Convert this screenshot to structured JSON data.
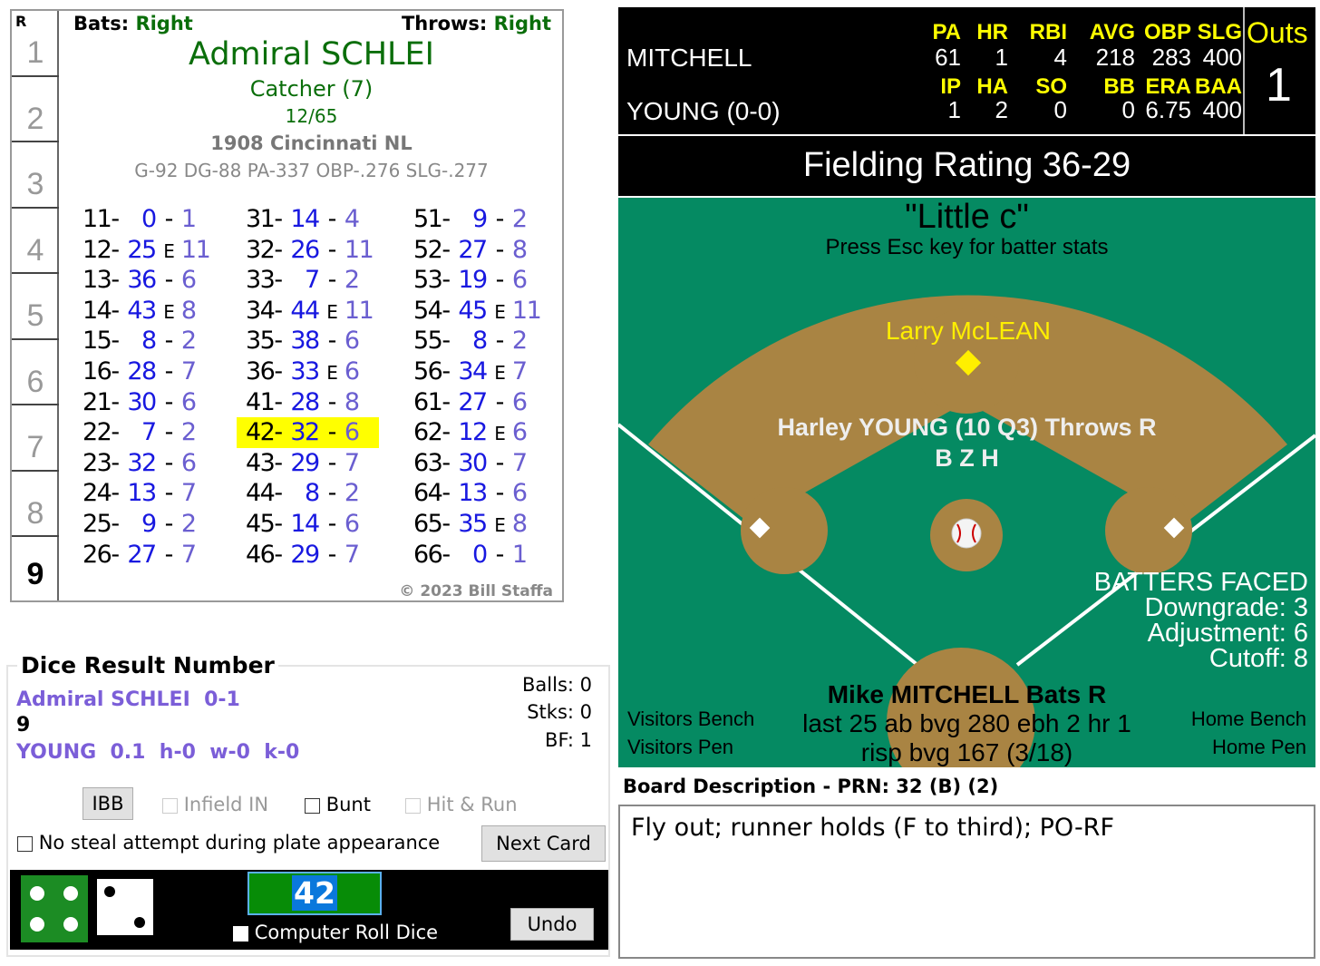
{
  "card": {
    "hand": "R",
    "rows": [
      "1",
      "2",
      "3",
      "4",
      "5",
      "6",
      "7",
      "8",
      "9"
    ],
    "current_row": "9",
    "bats_label": "Bats:",
    "bats": "Right",
    "throws_label": "Throws:",
    "throws": "Right",
    "name": "Admiral SCHLEI",
    "position": "Catcher (7)",
    "ratio": "12/65",
    "team": "1908 Cincinnati NL",
    "stats": "G-92 DG-88 PA-337 OBP-.276 SLG-.277",
    "copyright": "© 2023 Bill Staffa",
    "columns": [
      [
        [
          "11-",
          "0",
          "-",
          "1"
        ],
        [
          "12-",
          "25",
          "E",
          "11"
        ],
        [
          "13-",
          "36",
          "-",
          "6"
        ],
        [
          "14-",
          "43",
          "E",
          "8"
        ],
        [
          "15-",
          "8",
          "-",
          "2"
        ],
        [
          "16-",
          "28",
          "-",
          "7"
        ],
        [
          "21-",
          "30",
          "-",
          "6"
        ],
        [
          "22-",
          "7",
          "-",
          "2"
        ],
        [
          "23-",
          "32",
          "-",
          "6"
        ],
        [
          "24-",
          "13",
          "-",
          "7"
        ],
        [
          "25-",
          "9",
          "-",
          "2"
        ],
        [
          "26-",
          "27",
          "-",
          "7"
        ]
      ],
      [
        [
          "31-",
          "14",
          "-",
          "4"
        ],
        [
          "32-",
          "26",
          "-",
          "11"
        ],
        [
          "33-",
          "7",
          "-",
          "2"
        ],
        [
          "34-",
          "44",
          "E",
          "11"
        ],
        [
          "35-",
          "38",
          "-",
          "6"
        ],
        [
          "36-",
          "33",
          "E",
          "6"
        ],
        [
          "41-",
          "28",
          "-",
          "8"
        ],
        [
          "42-",
          "32",
          "-",
          "6"
        ],
        [
          "43-",
          "29",
          "-",
          "7"
        ],
        [
          "44-",
          "8",
          "-",
          "2"
        ],
        [
          "45-",
          "14",
          "-",
          "6"
        ],
        [
          "46-",
          "29",
          "-",
          "7"
        ]
      ],
      [
        [
          "51-",
          "9",
          "-",
          "2"
        ],
        [
          "52-",
          "27",
          "-",
          "8"
        ],
        [
          "53-",
          "19",
          "-",
          "6"
        ],
        [
          "54-",
          "45",
          "E",
          "11"
        ],
        [
          "55-",
          "8",
          "-",
          "2"
        ],
        [
          "56-",
          "34",
          "E",
          "7"
        ],
        [
          "61-",
          "27",
          "-",
          "6"
        ],
        [
          "62-",
          "12",
          "E",
          "6"
        ],
        [
          "63-",
          "30",
          "-",
          "7"
        ],
        [
          "64-",
          "13",
          "-",
          "6"
        ],
        [
          "65-",
          "35",
          "E",
          "8"
        ],
        [
          "66-",
          "0",
          "-",
          "1"
        ]
      ]
    ],
    "highlighted": "42-"
  },
  "dice": {
    "title": "Dice Result Number",
    "batter_line": "Admiral SCHLEI  0-1",
    "row": "9",
    "pitcher_line": "YOUNG  0.1  h-0  w-0  k-0",
    "balls": "Balls: 0",
    "strikes": "Stks: 0",
    "bf": "BF: 1",
    "ibb": "IBB",
    "infield_in": "Infield IN",
    "bunt": "Bunt",
    "hit_run": "Hit & Run",
    "no_steal": "No steal attempt during plate appearance",
    "next_card": "Next Card",
    "result": "42",
    "computer_roll": "Computer Roll Dice",
    "undo": "Undo",
    "die1": 4,
    "die2": 2
  },
  "scoreboard": {
    "batter": "MITCHELL",
    "pitcher": "YOUNG (0-0)",
    "bat_headers": [
      "PA",
      "HR",
      "RBI",
      "AVG",
      "OBP",
      "SLG"
    ],
    "bat_values": [
      "61",
      "1",
      "4",
      "218",
      "283",
      "400"
    ],
    "pit_headers": [
      "IP",
      "HA",
      "SO",
      "BB",
      "ERA",
      "BAA"
    ],
    "pit_values": [
      "1",
      "2",
      "0",
      "0",
      "6.75",
      "400"
    ],
    "outs_label": "Outs",
    "outs": "1",
    "fielding": "Fielding Rating 36-29"
  },
  "field": {
    "nickname": "\"Little c\"",
    "hint": "Press Esc key for batter stats",
    "second_base": "Larry McLEAN",
    "pitcher_info": "Harley YOUNG (10 Q3) Throws R",
    "pitcher_codes": "B Z H",
    "bf_title": "BATTERS FACED",
    "downgrade": "Downgrade: 3",
    "adjustment": "Adjustment: 6",
    "cutoff": "Cutoff: 8",
    "batter_name": "Mike MITCHELL Bats R",
    "batter_last25": "last 25 ab bvg 280 ebh 2 hr 1",
    "batter_risp": "risp bvg 167 (3/18)",
    "visitors_bench": "Visitors Bench",
    "visitors_pen": "Visitors Pen",
    "home_bench": "Home Bench",
    "home_pen": "Home Pen",
    "colors": {
      "grass": "#058a62",
      "dirt": "#a98443"
    }
  },
  "board": {
    "title": "Board Description - PRN: 32 (B) (2)",
    "text": "Fly out; runner holds (F to third); PO-RF"
  }
}
